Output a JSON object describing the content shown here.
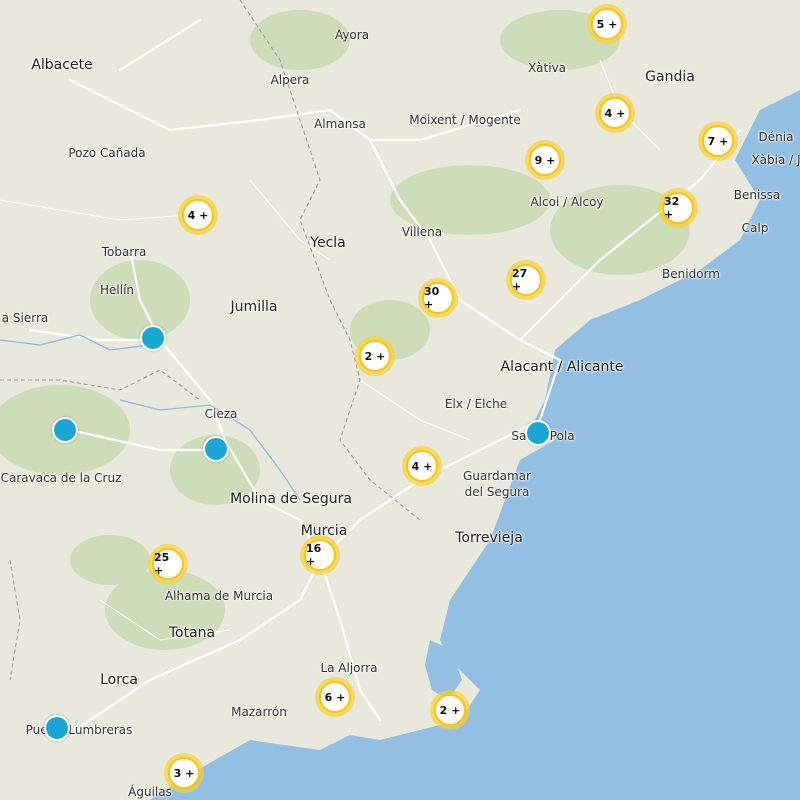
{
  "colors": {
    "land": "#e8e8dc",
    "sea": "#93bfe3",
    "forest": "#c9dab3",
    "road": "#ffffff",
    "cluster_ring": "#f7c41b",
    "marker": "#1aa7d6"
  },
  "places": {
    "albacete": "Albacete",
    "ayora": "Ayora",
    "xativa": "Xàtiva",
    "gandia": "Gandia",
    "alpera": "Alpera",
    "almansa": "Almansa",
    "moixent": "Moixent / Mogente",
    "denia": "Dénia",
    "xabia": "Xàbia / J",
    "pozo_canada": "Pozo Cañada",
    "benissa": "Benissa",
    "alcoi": "Alcoi / Alcoy",
    "calp": "Calp",
    "tobarra": "Tobarra",
    "yecla": "Yecla",
    "villena": "Villena",
    "benidorm": "Benidorm",
    "hellin": "Hellín",
    "jumilla": "Jumilla",
    "sierra": "a Sierra",
    "alicante": "Alacant / Alicante",
    "elx": "Elx / Elche",
    "cieza": "Cieza",
    "santa_pola": "Santa Pola",
    "caravaca": "Caravaca de la Cruz",
    "guardamar": "Guardamar",
    "del_segura": "del Segura",
    "molina": "Molina de Segura",
    "murcia": "Murcia",
    "torrevieja": "Torrevieja",
    "alhama": "Alhama de Murcia",
    "totana": "Totana",
    "aljorra": "La Aljorra",
    "lorca": "Lorca",
    "mazarron": "Mazarrón",
    "puerto_lumbreras": "Puerto Lumbreras",
    "aguilas": "Águilas"
  },
  "clusters": [
    "5 +",
    "4 +",
    "7 +",
    "9 +",
    "32 +",
    "4 +",
    "27 +",
    "30 +",
    "2 +",
    "4 +",
    "25 +",
    "16 +",
    "6 +",
    "2 +",
    "3 +"
  ],
  "markers": [
    "marker",
    "marker",
    "marker",
    "marker",
    "marker"
  ]
}
